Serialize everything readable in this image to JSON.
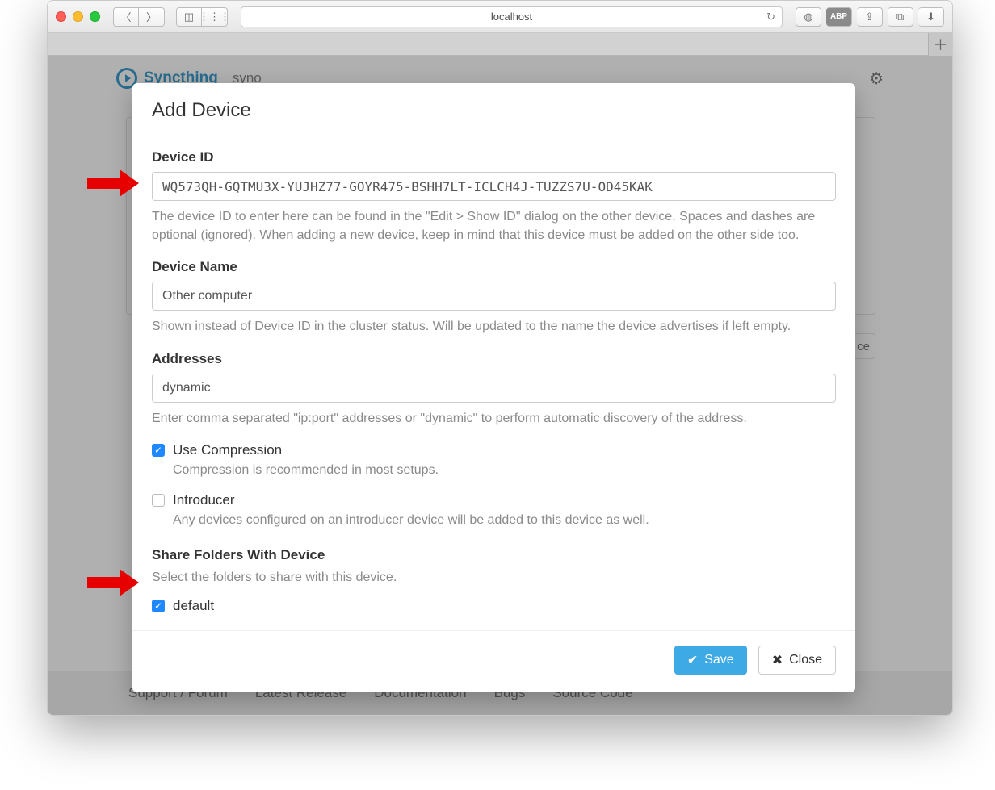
{
  "browser": {
    "url_display": "localhost"
  },
  "page": {
    "brand": "Syncthing",
    "node": "syno",
    "footer_links": [
      "Support / Forum",
      "Latest Release",
      "Documentation",
      "Bugs",
      "Source Code"
    ],
    "button_add_device_hint": "ce"
  },
  "modal": {
    "title": "Add Device",
    "device_id": {
      "label": "Device ID",
      "value": "WQ573QH-GQTMU3X-YUJHZ77-GOYR475-BSHH7LT-ICLCH4J-TUZZS7U-OD45KAK",
      "help": "The device ID to enter here can be found in the \"Edit > Show ID\" dialog on the other device. Spaces and dashes are optional (ignored). When adding a new device, keep in mind that this device must be added on the other side too."
    },
    "device_name": {
      "label": "Device Name",
      "value": "Other computer",
      "help": "Shown instead of Device ID in the cluster status. Will be updated to the name the device advertises if left empty."
    },
    "addresses": {
      "label": "Addresses",
      "value": "dynamic",
      "help": "Enter comma separated \"ip:port\" addresses or \"dynamic\" to perform automatic discovery of the address."
    },
    "use_compression": {
      "label": "Use Compression",
      "checked": true,
      "desc": "Compression is recommended in most setups."
    },
    "introducer": {
      "label": "Introducer",
      "checked": false,
      "desc": "Any devices configured on an introducer device will be added to this device as well."
    },
    "share_folders": {
      "label": "Share Folders With Device",
      "desc": "Select the folders to share with this device.",
      "folders": [
        {
          "name": "default",
          "checked": true
        }
      ]
    },
    "buttons": {
      "save": "Save",
      "close": "Close"
    }
  }
}
